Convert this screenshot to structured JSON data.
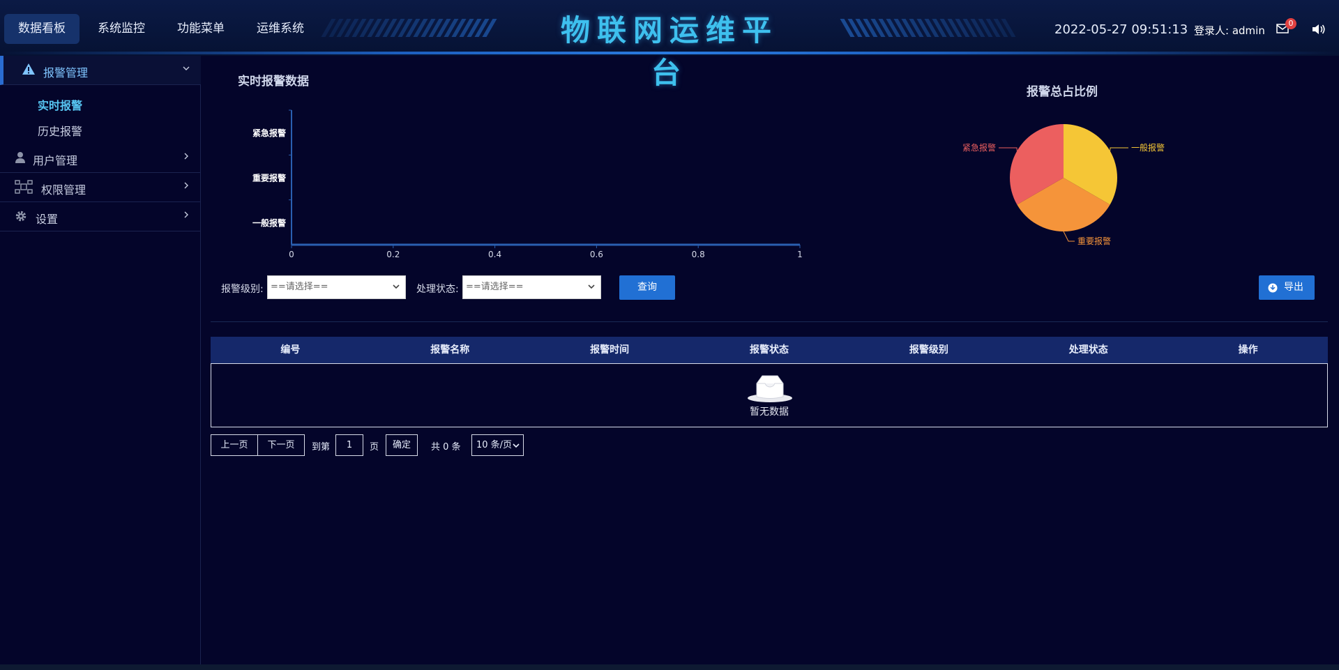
{
  "header": {
    "nav": [
      "数据看板",
      "系统监控",
      "功能菜单",
      "运维系统"
    ],
    "title": "物联网运维平台",
    "datetime": "2022-05-27 09:51:13",
    "login_label": "登录人: admin",
    "unread_count": "0",
    "mail_icon": "mail-icon",
    "sound_icon": "speaker-icon"
  },
  "sidebar": {
    "items": [
      {
        "label": "报警管理",
        "icon": "warning-icon",
        "expanded": true
      },
      {
        "label": "用户管理",
        "icon": "user-icon",
        "expanded": false
      },
      {
        "label": "权限管理",
        "icon": "network-icon",
        "expanded": false
      },
      {
        "label": "设置",
        "icon": "gear-icon",
        "expanded": false
      }
    ],
    "sub_items": [
      "实时报警",
      "历史报警"
    ]
  },
  "realtime": {
    "title": "实时报警数据"
  },
  "ratio": {
    "title": "报警总占比例"
  },
  "chart_data": [
    {
      "type": "bar",
      "orientation": "horizontal",
      "title": "实时报警数据",
      "categories": [
        "紧急报警",
        "重要报警",
        "一般报警"
      ],
      "values": [
        0,
        0,
        0
      ],
      "xlim": [
        0,
        1
      ],
      "xticks": [
        "0",
        "0.2",
        "0.4",
        "0.6",
        "0.8",
        "1"
      ],
      "grid": false
    },
    {
      "type": "pie",
      "title": "报警总占比例",
      "categories": [
        "一般报警",
        "重要报警",
        "紧急报警"
      ],
      "values": [
        1,
        1,
        1
      ],
      "colors": [
        "#f5c636",
        "#f5943a",
        "#ec5f5f"
      ]
    }
  ],
  "filters": {
    "level_label": "报警级别:",
    "level_value": "==请选择==",
    "status_label": "处理状态:",
    "status_value": "==请选择==",
    "query_label": "查询",
    "export_label": "导出"
  },
  "table": {
    "columns": [
      "编号",
      "报警名称",
      "报警时间",
      "报警状态",
      "报警级别",
      "处理状态",
      "操作"
    ],
    "empty_text": "暂无数据"
  },
  "pagination": {
    "prev": "上一页",
    "next": "下一页",
    "goto_label": "到第",
    "page_value": "1",
    "page_unit": "页",
    "confirm": "确定",
    "total": "共 0 条",
    "page_size": "10 条/页"
  },
  "colors": {
    "accent": "#2170d4",
    "title": "#3ec0ee",
    "background": "#04052a"
  }
}
